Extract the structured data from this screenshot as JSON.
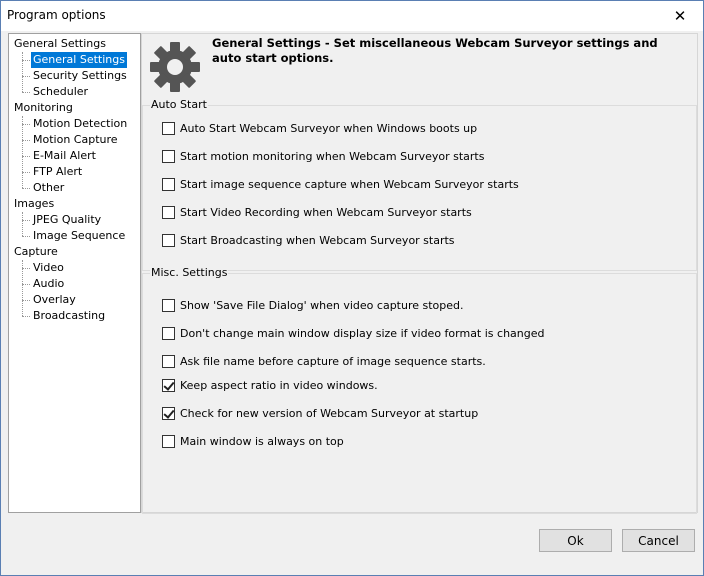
{
  "window": {
    "title": "Program options",
    "close_label": "✕"
  },
  "tree": {
    "items": [
      {
        "label": "General Settings",
        "level": 0
      },
      {
        "label": "General Settings",
        "level": 1,
        "selected": true
      },
      {
        "label": "Security Settings",
        "level": 1
      },
      {
        "label": "Scheduler",
        "level": 1
      },
      {
        "label": "Monitoring",
        "level": 0
      },
      {
        "label": "Motion Detection",
        "level": 1
      },
      {
        "label": "Motion Capture",
        "level": 1
      },
      {
        "label": "E-Mail Alert",
        "level": 1
      },
      {
        "label": "FTP Alert",
        "level": 1
      },
      {
        "label": "Other",
        "level": 1
      },
      {
        "label": "Images",
        "level": 0
      },
      {
        "label": "JPEG Quality",
        "level": 1
      },
      {
        "label": "Image Sequence",
        "level": 1
      },
      {
        "label": "Capture",
        "level": 0
      },
      {
        "label": "Video",
        "level": 1
      },
      {
        "label": "Audio",
        "level": 1
      },
      {
        "label": "Overlay",
        "level": 1
      },
      {
        "label": "Broadcasting",
        "level": 1
      }
    ]
  },
  "header": {
    "icon": "gear-icon",
    "text": "General Settings - Set miscellaneous Webcam Surveyor settings and auto start options."
  },
  "auto_start": {
    "label": "Auto Start",
    "options": [
      {
        "label": "Auto Start Webcam Surveyor when Windows boots up",
        "checked": false
      },
      {
        "label": "Start motion monitoring when Webcam Surveyor starts",
        "checked": false
      },
      {
        "label": "Start image sequence capture when Webcam Surveyor starts",
        "checked": false
      },
      {
        "label": "Start Video Recording when Webcam Surveyor starts",
        "checked": false
      },
      {
        "label": "Start Broadcasting when Webcam Surveyor starts",
        "checked": false
      }
    ]
  },
  "misc": {
    "label": "Misc. Settings",
    "options": [
      {
        "label": "Show 'Save File Dialog' when video capture stoped.",
        "checked": false
      },
      {
        "label": "Don't change main window display size if video format is changed",
        "checked": false
      },
      {
        "label": "Ask file name before capture of image sequence starts.",
        "checked": false
      },
      {
        "label": "Keep aspect ratio in video windows.",
        "checked": true
      },
      {
        "label": "Check for new version of Webcam Surveyor at startup",
        "checked": true
      },
      {
        "label": "Main window is always on top",
        "checked": false
      }
    ]
  },
  "buttons": {
    "ok": "Ok",
    "cancel": "Cancel"
  },
  "colors": {
    "selection": "#0078d7",
    "window_bg": "#f0f0f0",
    "gear": "#555555"
  }
}
